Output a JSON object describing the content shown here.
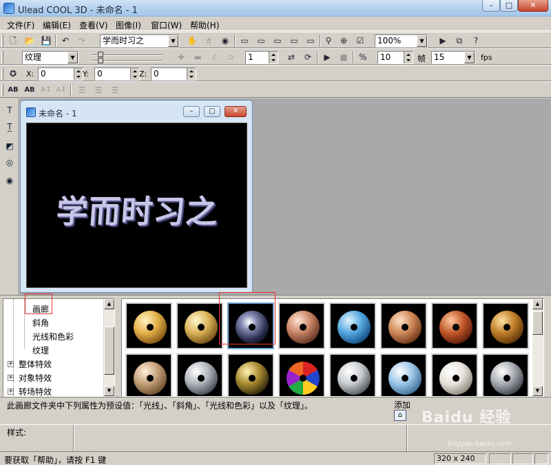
{
  "app": {
    "title": "Ulead COOL 3D - 未命名 - 1",
    "min": "–",
    "max": "□",
    "close": "✕"
  },
  "menu": [
    "文件(F)",
    "编辑(E)",
    "查看(V)",
    "图像(I)",
    "窗口(W)",
    "帮助(H)"
  ],
  "toolbar": {
    "object_combo": "学而时习之",
    "zoom_combo": "100%",
    "attribute_combo": "纹理",
    "frame_value": "1",
    "frame_count_value": "10",
    "frame_label": "帧",
    "fps_value": "15",
    "fps_label": "fps",
    "x_label": "X:",
    "x_value": "0",
    "y_label": "Y:",
    "y_value": "0",
    "z_label": "Z:",
    "z_value": "0"
  },
  "document": {
    "title": "未命名 - 1",
    "canvas_text": "学而时习之",
    "canvas_size_label": "320 x 240"
  },
  "tree": {
    "items": [
      {
        "label": "画廊",
        "selected": true
      },
      {
        "label": "斜角"
      },
      {
        "label": "光线和色彩"
      },
      {
        "label": "纹理"
      },
      {
        "label": "整体特效",
        "expandable": true
      },
      {
        "label": "对象特效",
        "expandable": true
      },
      {
        "label": "转场特效",
        "expandable": true
      }
    ]
  },
  "gallery": {
    "thumbnails": [
      {
        "style": "gold-ring"
      },
      {
        "style": "gold-ring-bright"
      },
      {
        "style": "chrome-dark",
        "selected": true
      },
      {
        "style": "copper"
      },
      {
        "style": "blue-stone"
      },
      {
        "style": "copper-etched"
      },
      {
        "style": "red-mosaic"
      },
      {
        "style": "bronze-dotted"
      },
      {
        "style": "tan-bumps"
      },
      {
        "style": "silver-carved"
      },
      {
        "style": "gold-flakes"
      },
      {
        "style": "stained-glass"
      },
      {
        "style": "silver-swirl"
      },
      {
        "style": "blue-water"
      },
      {
        "style": "white-marble"
      },
      {
        "style": "steel-rivets"
      }
    ]
  },
  "description": {
    "text": "此画廊文件夹中下列属性为预设值：「光线」、「斜角」、「光线和色彩」以及「纹理」。",
    "add_label": "添加"
  },
  "style_label": "样式:",
  "status": {
    "help_text": "要获取「帮助」，请按 F1 键",
    "size": "320 x 240"
  },
  "watermark": {
    "text": "Baidu 经验",
    "sub": "jingyan.baidu.com"
  }
}
